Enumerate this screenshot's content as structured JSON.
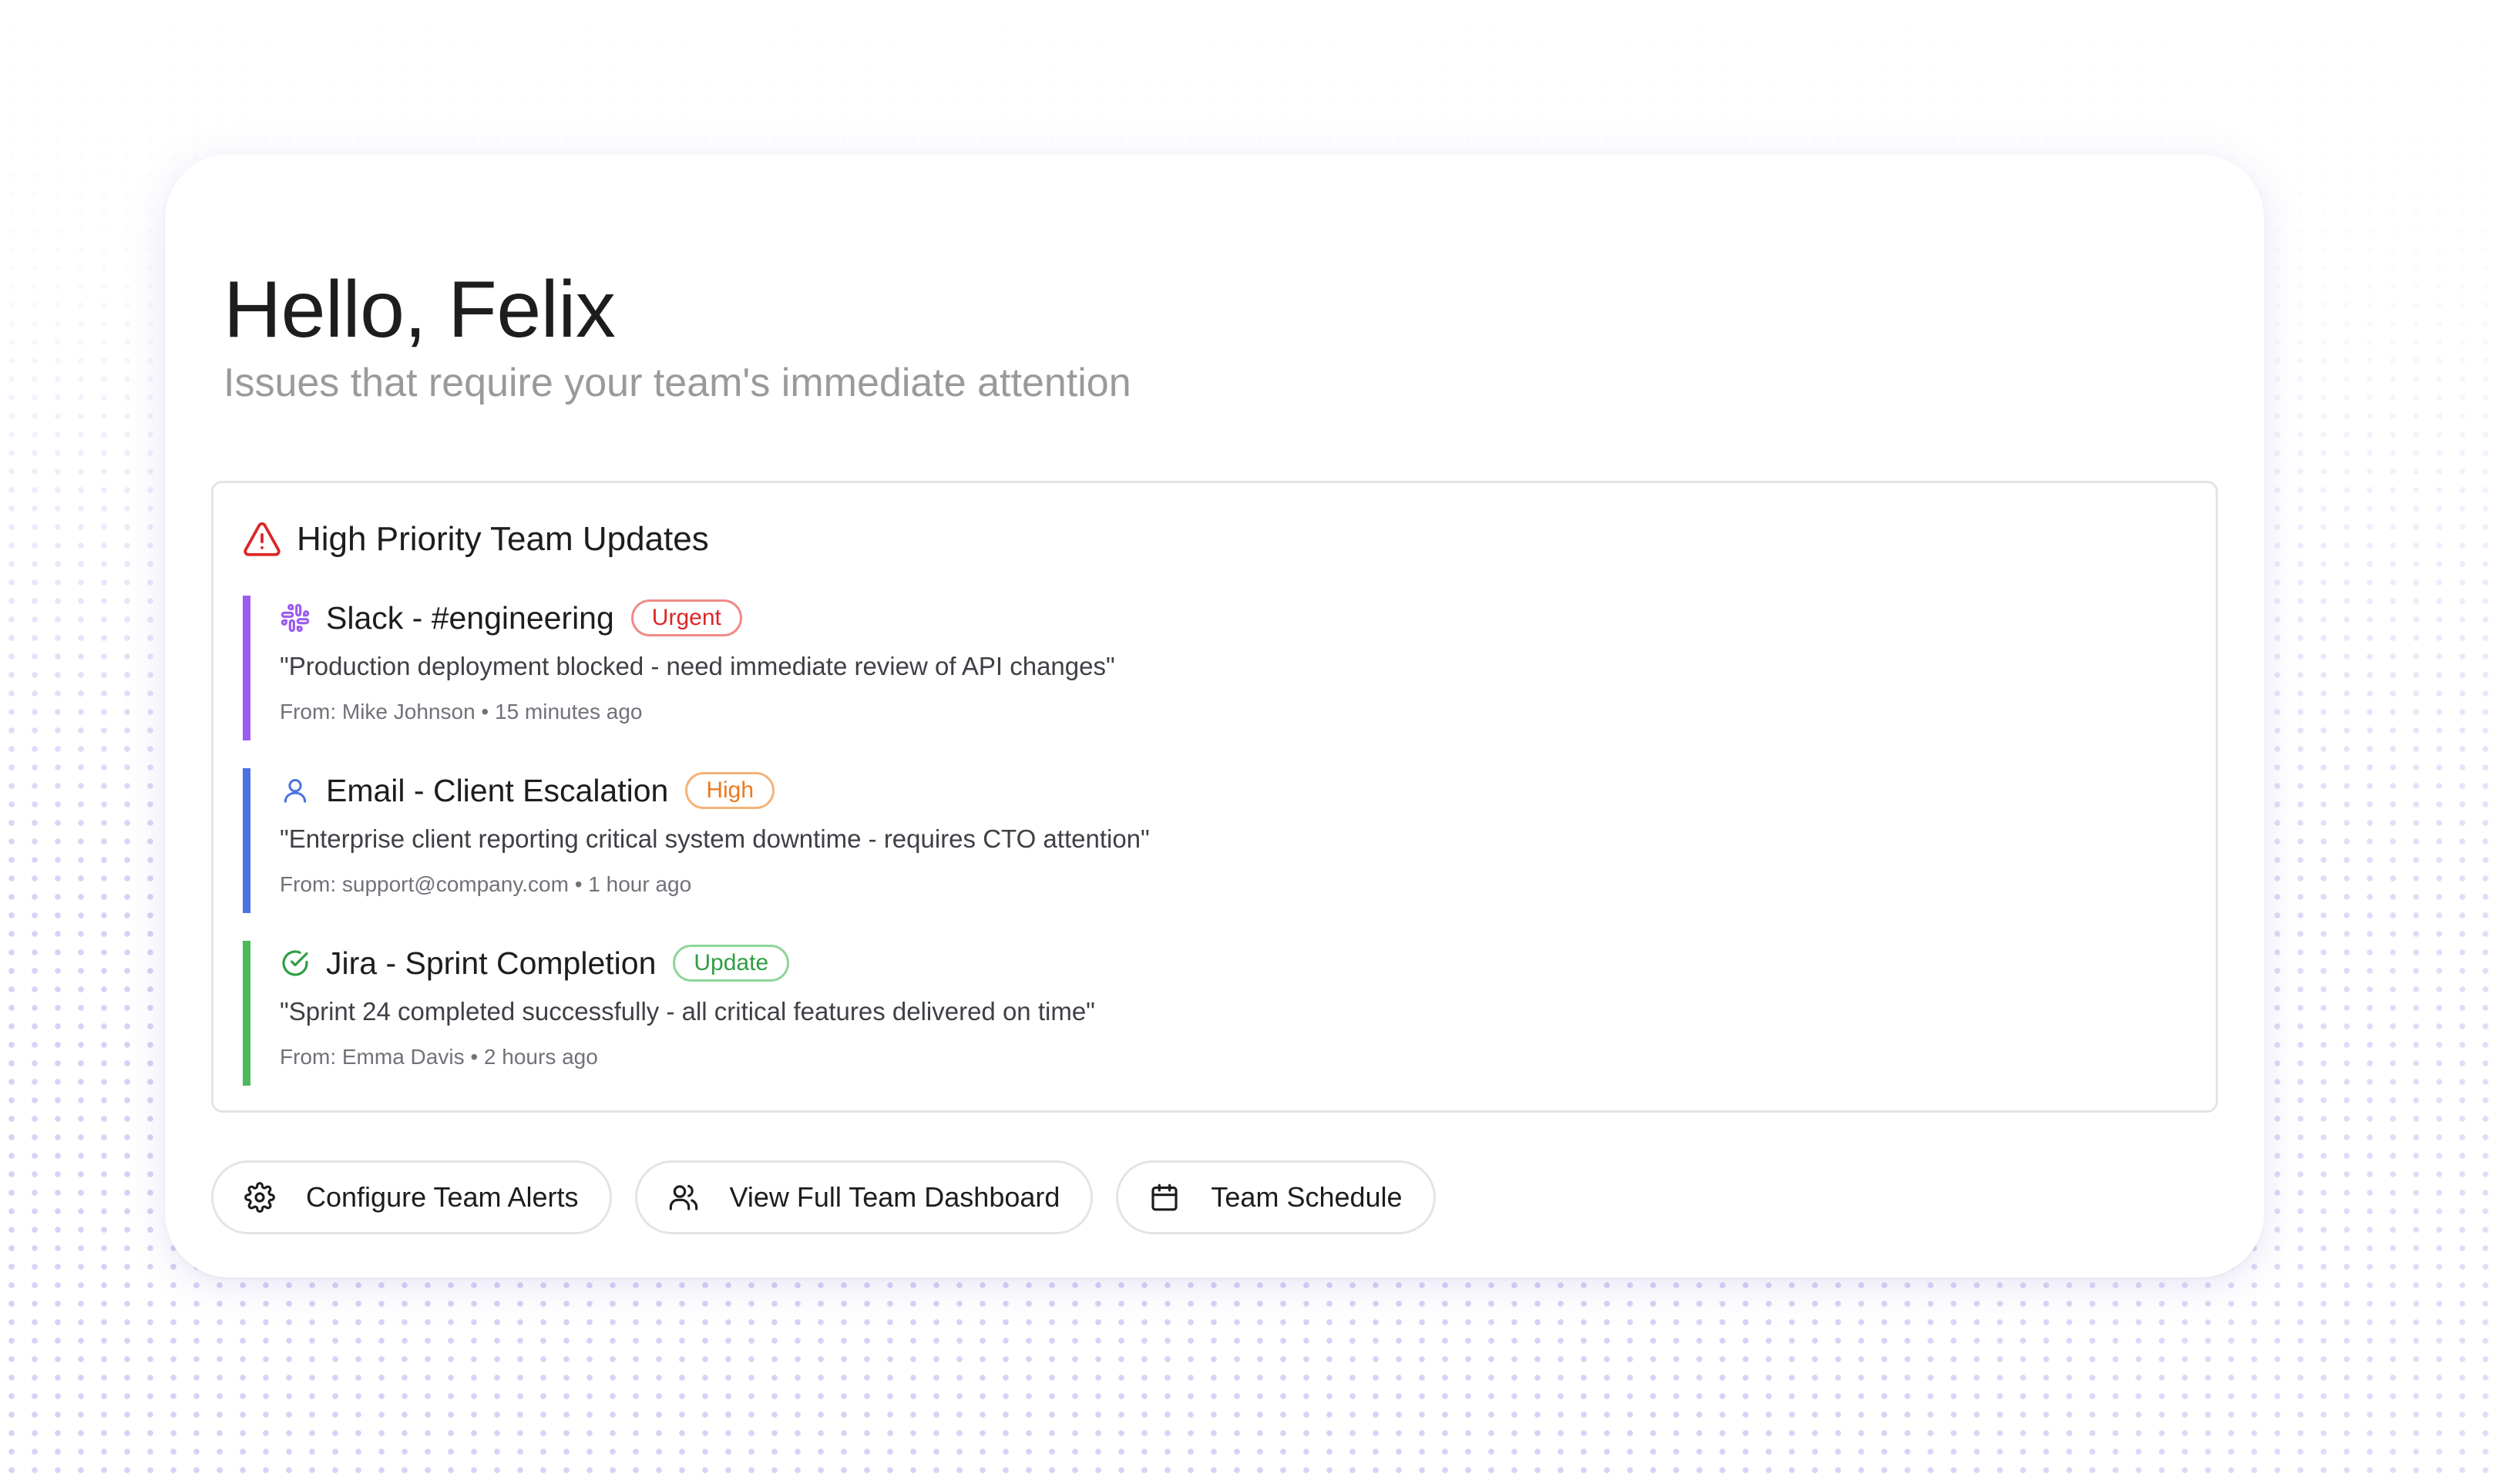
{
  "header": {
    "greeting": "Hello, Felix",
    "subtitle": "Issues that require your team's immediate attention"
  },
  "panel": {
    "icon": "alert-triangle-icon",
    "title": "High Priority Team Updates",
    "items": [
      {
        "icon": "slack-icon",
        "source": "Slack - #engineering",
        "badge": "Urgent",
        "quote": "\"Production deployment blocked - need immediate review of API changes\"",
        "meta": "From: Mike Johnson • 15 minutes ago",
        "accent": "#9b5cf0",
        "badge_color": "#dc2626"
      },
      {
        "icon": "user-icon",
        "source": "Email - Client Escalation",
        "badge": "High",
        "quote": "\"Enterprise client reporting critical system downtime - requires CTO attention\"",
        "meta": "From: support@company.com • 1 hour ago",
        "accent": "#4a72e0",
        "badge_color": "#ea7a1f"
      },
      {
        "icon": "check-circle-icon",
        "source": "Jira - Sprint Completion",
        "badge": "Update",
        "quote": "\"Sprint 24 completed successfully - all critical features delivered on time\"",
        "meta": "From: Emma Davis • 2 hours ago",
        "accent": "#4cb95a",
        "badge_color": "#2f9e44"
      }
    ]
  },
  "actions": [
    {
      "icon": "gear-icon",
      "label": "Configure Team Alerts"
    },
    {
      "icon": "users-icon",
      "label": "View Full Team Dashboard"
    },
    {
      "icon": "calendar-icon",
      "label": "Team Schedule"
    }
  ],
  "colors": {
    "alert_red": "#dc2626",
    "slack_purple": "#9b5cf0",
    "email_blue": "#4a72e0",
    "jira_green": "#4cb95a"
  }
}
